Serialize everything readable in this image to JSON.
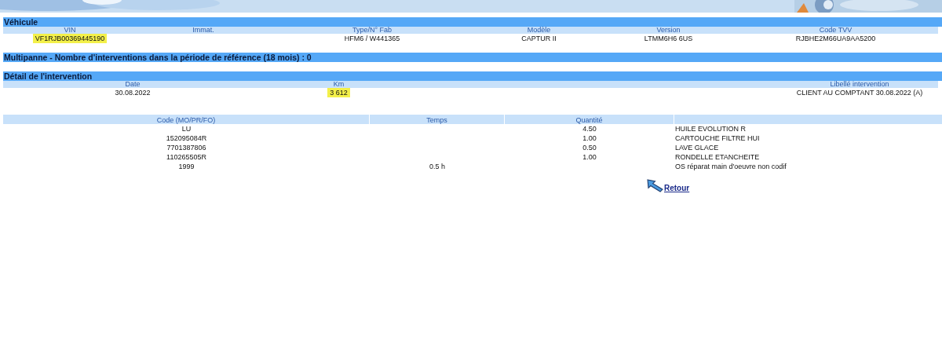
{
  "vehicle": {
    "title": "Véhicule",
    "fields": [
      {
        "label": "VIN",
        "value": "VF1RJB00369445190",
        "highlighted": true
      },
      {
        "label": "Immat."
      },
      {
        "label": "Type/N° Fab",
        "value": "HFM6 / W441365",
        "highlighted": false
      },
      {
        "label": "Modèle",
        "value": "CAPTUR II",
        "highlighted": false
      },
      {
        "label": "Version",
        "value": "LTMM6H6 6US",
        "highlighted": false
      },
      {
        "label": "Code TVV",
        "value": "RJBHE2M66UA9AA5200",
        "highlighted": false
      }
    ]
  },
  "multipanne": {
    "title": "Multipanne - Nombre d'interventions dans la période de référence (18 mois) : 0"
  },
  "detail": {
    "title": "Détail de l'intervention",
    "fields": [
      {
        "label": "Date",
        "value": "30.08.2022",
        "highlighted": false
      },
      {
        "label": "Km",
        "value": "3 612",
        "highlighted": true
      },
      {
        "label": "Libellé intervention",
        "value": "CLIENT AU COMPTANT 30.08.2022 (A)",
        "highlighted": false
      }
    ]
  },
  "lines": {
    "columns": [
      "Code (MO/PR/FO)",
      "Temps",
      "Quantité"
    ],
    "rows": [
      {
        "code": "LU",
        "quantity": "4.50",
        "description": "HUILE EVOLUTION R"
      },
      {
        "code": "152095084R",
        "quantity": "1.00",
        "description": "CARTOUCHE FILTRE HUI"
      },
      {
        "code": "7701387806",
        "quantity": "0.50",
        "description": "LAVE GLACE"
      },
      {
        "code": "110265505R",
        "quantity": "1.00",
        "description": "RONDELLE ETANCHEITE"
      },
      {
        "code": "1999",
        "time": "0.5 h",
        "description": "OS réparat main d'oeuvre non codif"
      }
    ]
  },
  "back_link": "Retour"
}
